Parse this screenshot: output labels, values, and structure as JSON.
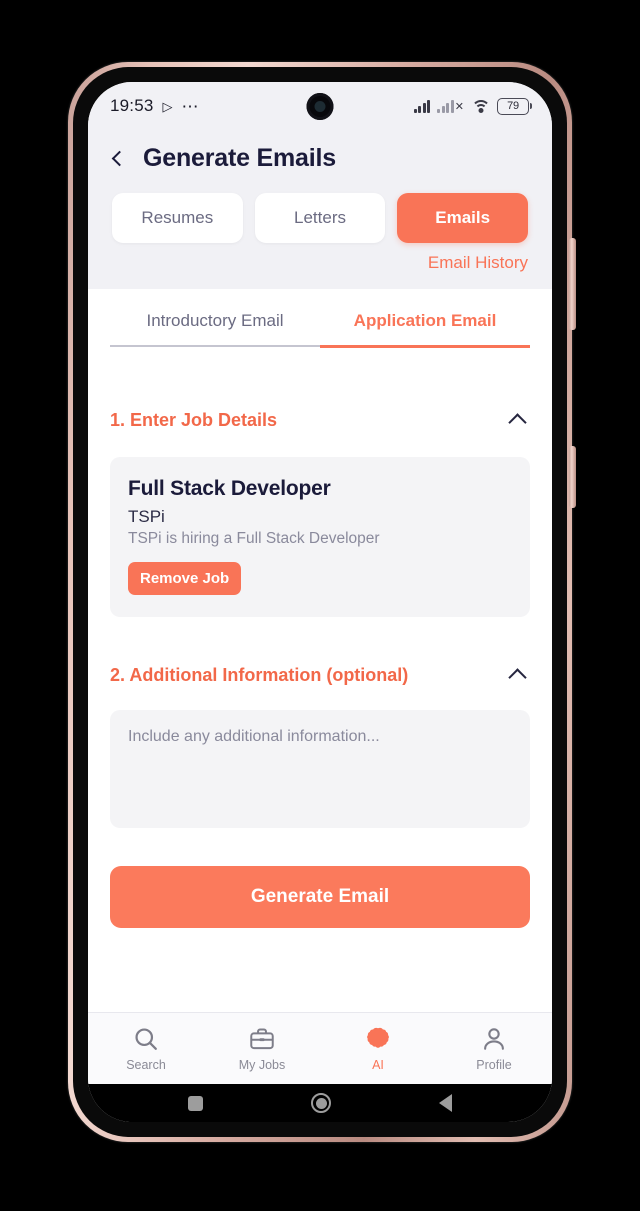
{
  "status_bar": {
    "time": "19:53",
    "play_icon": "play-icon",
    "overflow_icon": "more-dots-icon",
    "signal_icon": "signal-bars-icon",
    "sim2_icon": "signal-no-service-icon",
    "wifi_icon": "wifi-icon",
    "battery_level": "79"
  },
  "header": {
    "back_icon": "back-chevron-icon",
    "title": "Generate Emails",
    "segments": [
      {
        "label": "Resumes",
        "active": false
      },
      {
        "label": "Letters",
        "active": false
      },
      {
        "label": "Emails",
        "active": true
      }
    ],
    "history_link": "Email History"
  },
  "tabs": [
    {
      "label": "Introductory Email",
      "active": false
    },
    {
      "label": "Application Email",
      "active": true
    }
  ],
  "sections": {
    "job_details": {
      "title": "1. Enter Job Details",
      "chevron": "chevron-up-icon",
      "job": {
        "title": "Full Stack Developer",
        "company": "TSPi",
        "description": "TSPi is hiring a Full Stack Developer",
        "remove_label": "Remove Job"
      }
    },
    "additional_info": {
      "title": "2. Additional Information (optional)",
      "chevron": "chevron-up-icon",
      "placeholder": "Include any additional information...",
      "value": ""
    }
  },
  "primary_action": {
    "label": "Generate Email"
  },
  "bottom_nav": [
    {
      "label": "Search",
      "icon": "search-icon",
      "active": false
    },
    {
      "label": "My Jobs",
      "icon": "briefcase-icon",
      "active": false
    },
    {
      "label": "AI",
      "icon": "brain-icon",
      "active": true
    },
    {
      "label": "Profile",
      "icon": "person-icon",
      "active": false
    }
  ],
  "android_nav": [
    {
      "name": "recents-button",
      "icon": "square-icon"
    },
    {
      "name": "home-button",
      "icon": "circle-icon"
    },
    {
      "name": "back-button",
      "icon": "triangle-icon"
    }
  ],
  "colors": {
    "accent": "#f97457",
    "accent_dark": "#f26849",
    "title": "#1b1b3a",
    "muted": "#8a8a9c",
    "panel": "#f4f4f6",
    "header_bg": "#f1f1f5"
  }
}
